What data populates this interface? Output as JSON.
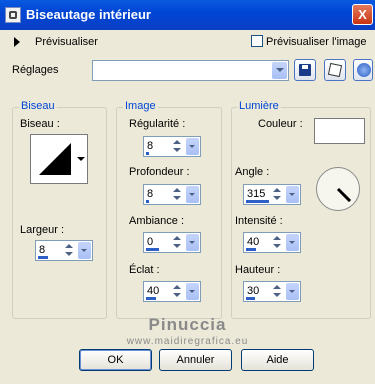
{
  "window": {
    "title": "Biseautage intérieur",
    "close_label": "X"
  },
  "preview": {
    "label": "Prévisualiser",
    "checkbox_label": "Prévisualiser l'image",
    "checked": false
  },
  "presets": {
    "label": "Réglages",
    "value": ""
  },
  "groups": {
    "bevel": {
      "title": "Biseau",
      "bevel_label": "Biseau :",
      "width_label": "Largeur :",
      "width_value": "8",
      "width_level": 0.4
    },
    "image": {
      "title": "Image",
      "smoothness_label": "Régularité :",
      "smoothness_value": "8",
      "smoothness_level": 0.1,
      "depth_label": "Profondeur :",
      "depth_value": "8",
      "depth_level": 0.1,
      "ambience_label": "Ambiance :",
      "ambience_value": "0",
      "ambience_level": 0.5,
      "shininess_label": "Éclat :",
      "shininess_value": "40",
      "shininess_level": 0.4
    },
    "light": {
      "title": "Lumière",
      "color_label": "Couleur :",
      "color_value": "#ffffff",
      "angle_label": "Angle :",
      "angle_value": "315",
      "angle_level": 0.88,
      "intensity_label": "Intensité :",
      "intensity_value": "40",
      "intensity_level": 0.4,
      "elevation_label": "Hauteur :",
      "elevation_value": "30",
      "elevation_level": 0.33
    }
  },
  "watermark": {
    "line1": "Pinuccia",
    "line2": "www.maidiregrafica.eu"
  },
  "buttons": {
    "ok": "OK",
    "cancel": "Annuler",
    "help": "Aide"
  },
  "colors": {
    "title_bar": "#0046d5",
    "group_title": "#0046d5",
    "background": "#ece9d8",
    "accent": "#2d5fc7"
  },
  "icons": [
    "dialog-app-icon",
    "close-icon",
    "collapse-arrow-icon",
    "save-preset-icon",
    "randomize-icon",
    "reset-icon"
  ]
}
